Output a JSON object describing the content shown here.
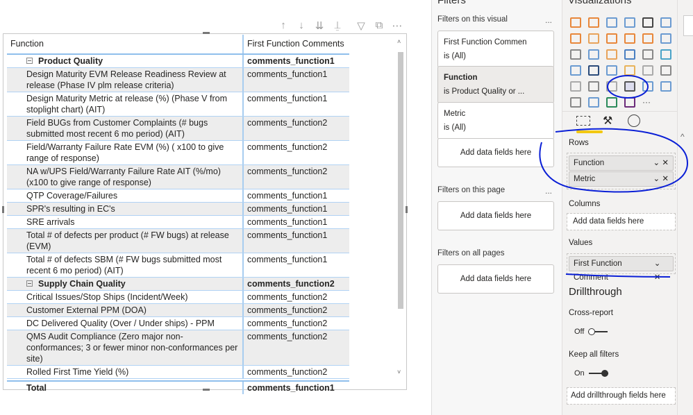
{
  "visual_toolbar": {
    "icons": [
      "arrow-up-icon",
      "arrow-down-icon",
      "double-arrow-down-icon",
      "expand-hierarchy-icon",
      "filter-icon",
      "focus-mode-icon",
      "more-options-icon"
    ]
  },
  "table": {
    "headers": [
      "Function",
      "First Function Comments"
    ],
    "groups": [
      {
        "name": "Product Quality",
        "value": "comments_function1",
        "rows": [
          {
            "metric": "Design Maturity EVM Release Readiness Review at release (Phase IV plm release criteria)",
            "value": "comments_function1"
          },
          {
            "metric": "Design Maturity Metric at release (%) (Phase V from stoplight chart) (AIT)",
            "value": "comments_function1"
          },
          {
            "metric": "Field BUGs from Customer Complaints (# bugs submitted most recent 6 mo period) (AIT)",
            "value": "comments_function2"
          },
          {
            "metric": "Field/Warranty Failure Rate EVM (%) ( x100 to give range of response)",
            "value": "comments_function2"
          },
          {
            "metric": "NA w/UPS Field/Warranty Failure Rate AIT (%/mo) (x100 to give range of response)",
            "value": "comments_function2"
          },
          {
            "metric": "QTP Coverage/Failures",
            "value": "comments_function1"
          },
          {
            "metric": "SPR's resulting in EC's",
            "value": "comments_function1"
          },
          {
            "metric": "SRE arrivals",
            "value": "comments_function1"
          },
          {
            "metric": "Total # of defects per product  (# FW bugs) at release (EVM)",
            "value": "comments_function1"
          },
          {
            "metric": "Total # of defects SBM (# FW bugs submitted most recent 6 mo period) (AIT)",
            "value": "comments_function1"
          }
        ]
      },
      {
        "name": "Supply Chain Quality",
        "value": "comments_function2",
        "rows": [
          {
            "metric": "Critical Issues/Stop Ships (Incident/Week)",
            "value": "comments_function2"
          },
          {
            "metric": "Customer External PPM (DOA)",
            "value": "comments_function2"
          },
          {
            "metric": "DC Delivered Quality (Over / Under ships) - PPM",
            "value": "comments_function2"
          },
          {
            "metric": "QMS Audit Compliance (Zero major non-conformances; 3 or fewer minor non-conformances per site)",
            "value": "comments_function2"
          },
          {
            "metric": "Rolled First Time Yield (%)",
            "value": "comments_function2"
          }
        ]
      }
    ],
    "total": {
      "label": "Total",
      "value": "comments_function1"
    }
  },
  "filters": {
    "title": "Filters",
    "on_visual": "Filters on this visual",
    "cards": [
      {
        "name": "First Function Commen",
        "state": "is (All)"
      },
      {
        "name": "Function",
        "state": "is Product Quality or ..."
      },
      {
        "name": "Metric",
        "state": "is (All)"
      }
    ],
    "add": "Add data fields here",
    "on_page": "Filters on this page",
    "on_all": "Filters on all pages",
    "more": "..."
  },
  "viz": {
    "title": "Visualizations",
    "selected_visual": "matrix",
    "accent": "#f2c811",
    "rows_label": "Rows",
    "rows": [
      "Function",
      "Metric"
    ],
    "columns_label": "Columns",
    "columns_add": "Add data fields here",
    "values_label": "Values",
    "values": [
      "First Function Comment"
    ],
    "drillthrough": "Drillthrough",
    "cross_report": "Cross-report",
    "cross_state": "Off",
    "keep_filters": "Keep all filters",
    "keep_state": "On",
    "drill_add": "Add drillthrough fields here",
    "more": "..."
  },
  "annotation_color": "#0a1fd6"
}
